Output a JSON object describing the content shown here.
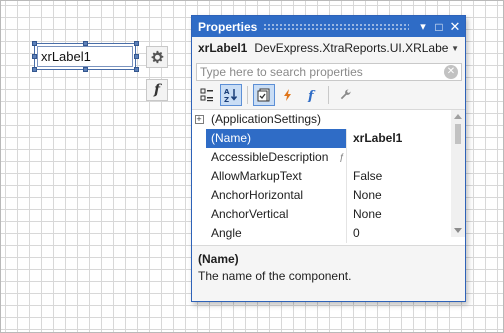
{
  "designer": {
    "label_text": "xrLabel1",
    "side_buttons": [
      {
        "icon": "gear-icon"
      },
      {
        "icon": "function-icon",
        "glyph": "f"
      }
    ]
  },
  "properties": {
    "title": "Properties",
    "title_buttons": [
      {
        "icon": "dropdown-arrow-icon",
        "glyph": "▾"
      },
      {
        "icon": "maximize-icon",
        "glyph": "□"
      },
      {
        "icon": "close-icon",
        "glyph": "✕"
      }
    ],
    "object": {
      "name": "xrLabel1",
      "type": "DevExpress.XtraReports.UI.XRLabel"
    },
    "search": {
      "placeholder": "Type here to search properties",
      "value": ""
    },
    "toolbar": [
      {
        "name": "categorized-icon",
        "active": false
      },
      {
        "name": "alphabetical-icon",
        "active": true
      },
      {
        "name": "properties-icon",
        "active": true
      },
      {
        "name": "events-icon",
        "active": false
      },
      {
        "name": "expressions-icon",
        "active": false
      },
      {
        "name": "settings-wrench-icon",
        "active": false
      }
    ],
    "rows": [
      {
        "name": "(ApplicationSettings)",
        "value": "",
        "expandable": true
      },
      {
        "name": "(Name)",
        "value": "xrLabel1",
        "selected": true
      },
      {
        "name": "AccessibleDescription",
        "value": "",
        "has_expression": true
      },
      {
        "name": "AllowMarkupText",
        "value": "False"
      },
      {
        "name": "AnchorHorizontal",
        "value": "None"
      },
      {
        "name": "AnchorVertical",
        "value": "None"
      },
      {
        "name": "Angle",
        "value": "0"
      }
    ],
    "description": {
      "title": "(Name)",
      "text": "The name of the component."
    }
  },
  "colors": {
    "accent": "#2f6cc6",
    "selection_handle": "#5b7fb8"
  }
}
